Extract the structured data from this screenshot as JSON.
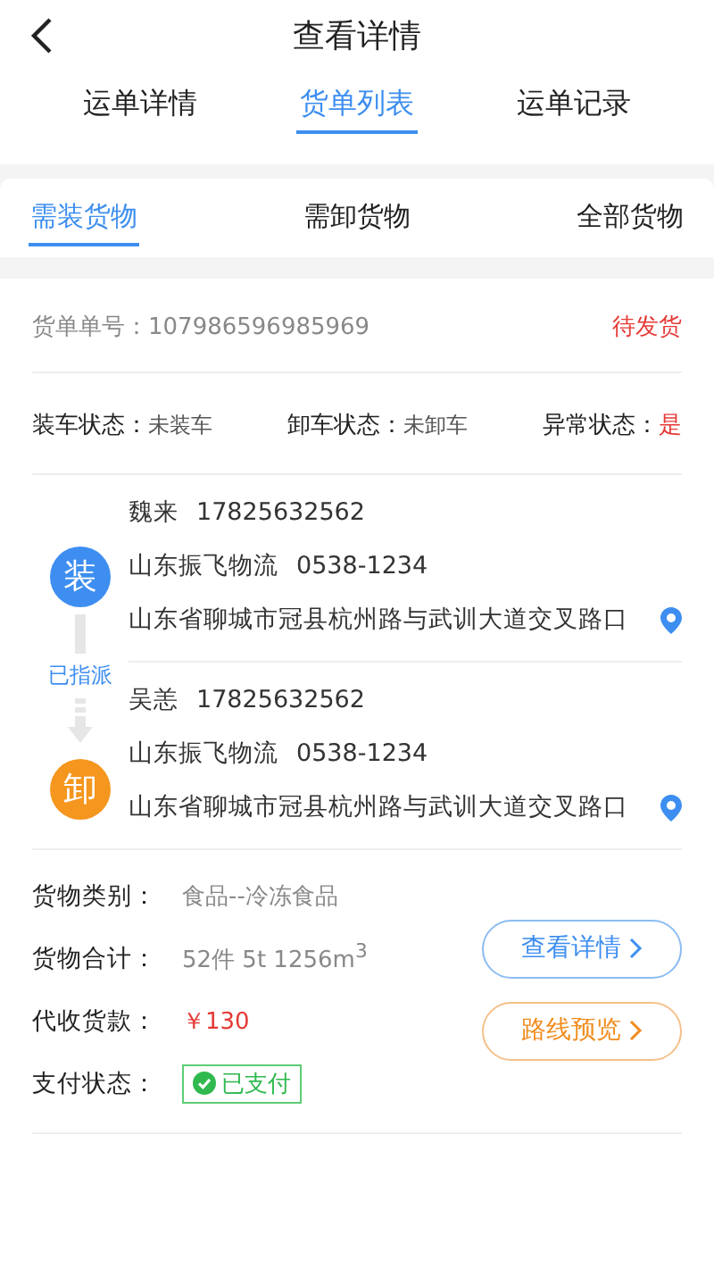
{
  "header": {
    "title": "查看详情"
  },
  "tabs": [
    {
      "label": "运单详情",
      "selected": false
    },
    {
      "label": "货单列表",
      "selected": true
    },
    {
      "label": "运单记录",
      "selected": false
    }
  ],
  "sub_tabs": [
    {
      "label": "需装货物",
      "selected": true
    },
    {
      "label": "需卸货物",
      "selected": false
    },
    {
      "label": "全部货物",
      "selected": false
    }
  ],
  "order": {
    "number_label": "货单单号：",
    "number": "107986596985969",
    "status": "待发货"
  },
  "states": [
    {
      "label": "装车状态：",
      "value": "未装车",
      "alert": false
    },
    {
      "label": "卸车状态：",
      "value": "未卸车",
      "alert": false
    },
    {
      "label": "异常状态：",
      "value": "是",
      "alert": true
    }
  ],
  "stops": [
    {
      "kind": "load",
      "badge": "装",
      "name": "魏来",
      "phone": "17825632562",
      "company": "山东振飞物流",
      "company_phone": "0538-1234",
      "address": "山东省聊城市冠县杭州路与武训大道交叉路口"
    },
    {
      "kind": "unload",
      "badge": "卸",
      "name": "吴恙",
      "phone": "17825632562",
      "company": "山东振飞物流",
      "company_phone": "0538-1234",
      "address": "山东省聊城市冠县杭州路与武训大道交叉路口"
    }
  ],
  "assignment": "已指派",
  "details": [
    {
      "kind": "text",
      "label": "货物类别：",
      "value": "食品--冷冻食品"
    },
    {
      "kind": "text",
      "label": "货物合计：",
      "value": "52件  5t  1256m$^{3}$"
    },
    {
      "kind": "price",
      "label": "代收货款：",
      "value": "￥130"
    },
    {
      "kind": "paid",
      "label": "支付状态：",
      "value": "已支付"
    }
  ],
  "buttons": [
    {
      "kind": "blue",
      "label": "查看详情"
    },
    {
      "kind": "orange",
      "label": "路线预览"
    }
  ]
}
